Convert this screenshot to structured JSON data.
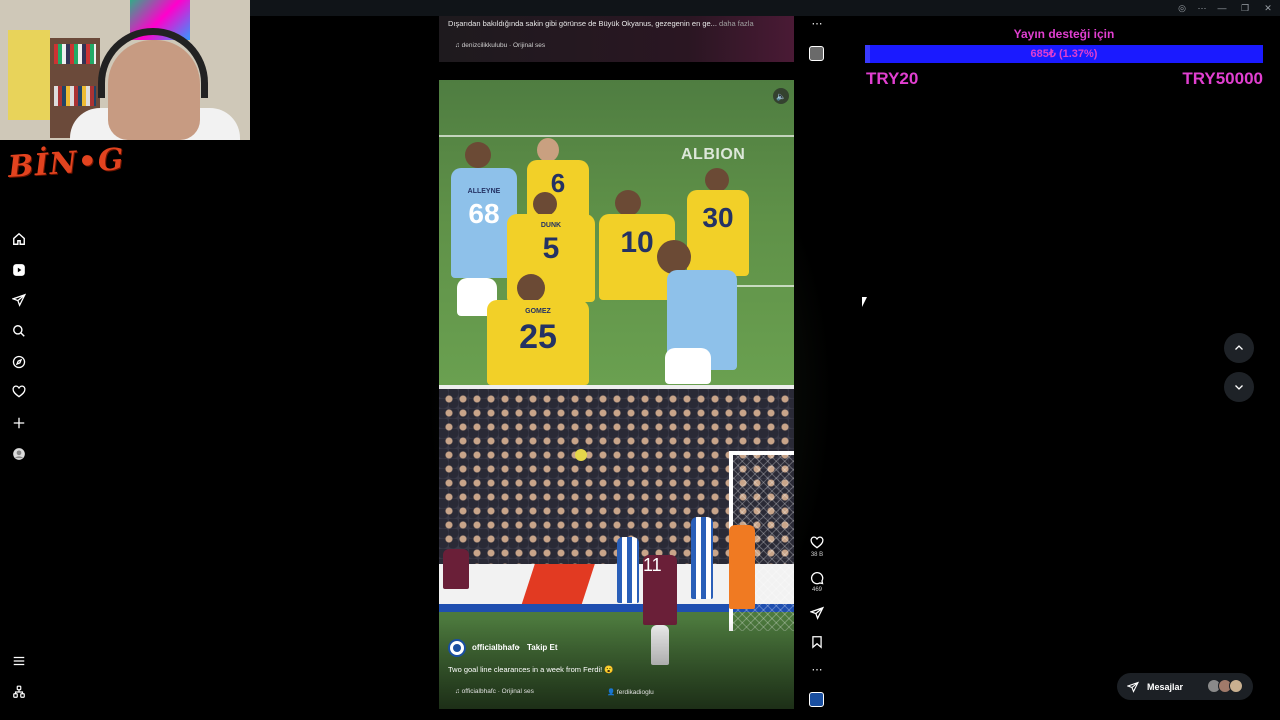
{
  "window": {
    "controls": [
      {
        "name": "extension-icon",
        "glyph": "◎"
      },
      {
        "name": "more-icon",
        "glyph": "⋯"
      },
      {
        "name": "minimize-icon",
        "glyph": "—"
      },
      {
        "name": "restore-icon",
        "glyph": "❐"
      },
      {
        "name": "close-icon",
        "glyph": "✕"
      }
    ]
  },
  "stream": {
    "brand_text": "BİN•G"
  },
  "sidebar": {
    "items": [
      {
        "name": "home-icon",
        "label": "Ana Sayfa"
      },
      {
        "name": "reels-icon",
        "label": "Reels"
      },
      {
        "name": "direct-icon",
        "label": "Mesajlar"
      },
      {
        "name": "search-icon",
        "label": "Ara"
      },
      {
        "name": "explore-icon",
        "label": "Keşfet"
      },
      {
        "name": "heart-icon",
        "label": "Bildirimler"
      },
      {
        "name": "create-icon",
        "label": "Oluştur"
      },
      {
        "name": "profile-icon",
        "label": "Profil"
      }
    ],
    "bottom": [
      {
        "name": "menu-icon"
      },
      {
        "name": "meta-icon"
      }
    ]
  },
  "prev_reel": {
    "caption": "Dışarıdan bakıldığında sakin gibi görünse de Büyük Okyanus, gezegenin en ge...",
    "more": "daha fazla",
    "audio": "♫ denizcilikkulubu · Orijinal ses"
  },
  "reel": {
    "watermark": "ALBION",
    "username": "officialbhafc",
    "separator": "•",
    "follow": "Takip Et",
    "caption": "Two goal line clearances in a week from Ferdi! 😮",
    "audio": "♫ officialbhafc · Orijinal ses",
    "tagged": "👤 ferdikadioglu",
    "top_players": [
      {
        "num": "68",
        "name": "ALLEYNE"
      },
      {
        "num": "6",
        "name": ""
      },
      {
        "num": "5",
        "name": "DUNK"
      },
      {
        "num": "10",
        "name": ""
      },
      {
        "num": "30",
        "name": ""
      },
      {
        "num": "25",
        "name": "GOMEZ"
      }
    ],
    "bottom_player_number": "11"
  },
  "actions": {
    "likes": "38 B",
    "comments": "469"
  },
  "donation": {
    "title": "Yayın desteği için",
    "bar_text": "685₺ (1.37%)",
    "progress_percent": 1.37,
    "min": "TRY20",
    "max": "TRY50000"
  },
  "messages": {
    "label": "Mesajlar"
  },
  "colors": {
    "accent_magenta": "#e13fd0",
    "bar_blue": "#1a1aff",
    "brighton_yellow": "#f2d028",
    "city_blue": "#7fb6e6"
  }
}
